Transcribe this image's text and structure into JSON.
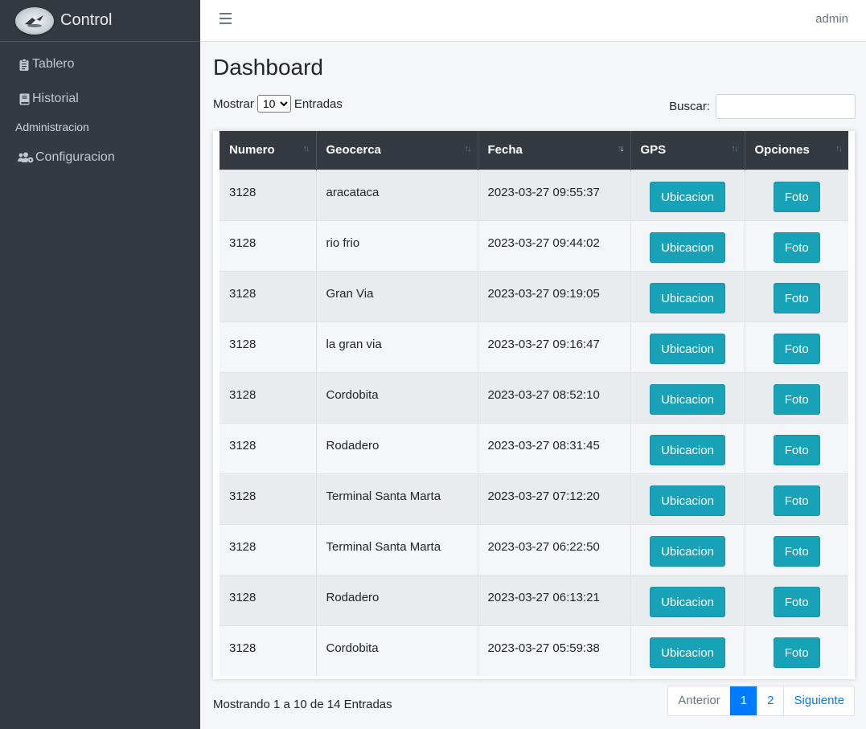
{
  "brand": {
    "name": "Control"
  },
  "sidebar": {
    "items": [
      {
        "label": "Tablero",
        "icon": "clipboard-icon"
      },
      {
        "label": "Historial",
        "icon": "book-icon"
      }
    ],
    "header": "Administracion",
    "admin_items": [
      {
        "label": "Configuracion",
        "icon": "users-cog-icon"
      }
    ]
  },
  "topbar": {
    "user": "admin"
  },
  "page": {
    "title": "Dashboard"
  },
  "table_controls": {
    "show_label": "Mostrar",
    "entries_label": "Entradas",
    "page_length": "10",
    "search_label": "Buscar:",
    "search_value": ""
  },
  "table": {
    "headers": [
      "Numero",
      "Geocerca",
      "Fecha",
      "GPS",
      "Opciones"
    ],
    "rows": [
      {
        "numero": "3128",
        "geocerca": "aracataca",
        "fecha": "2023-03-27 09:55:37",
        "gps": "Ubicacion",
        "opciones": "Foto"
      },
      {
        "numero": "3128",
        "geocerca": "rio frio",
        "fecha": "2023-03-27 09:44:02",
        "gps": "Ubicacion",
        "opciones": "Foto"
      },
      {
        "numero": "3128",
        "geocerca": "Gran Via",
        "fecha": "2023-03-27 09:19:05",
        "gps": "Ubicacion",
        "opciones": "Foto"
      },
      {
        "numero": "3128",
        "geocerca": "la gran via",
        "fecha": "2023-03-27 09:16:47",
        "gps": "Ubicacion",
        "opciones": "Foto"
      },
      {
        "numero": "3128",
        "geocerca": "Cordobita",
        "fecha": "2023-03-27 08:52:10",
        "gps": "Ubicacion",
        "opciones": "Foto"
      },
      {
        "numero": "3128",
        "geocerca": "Rodadero",
        "fecha": "2023-03-27 08:31:45",
        "gps": "Ubicacion",
        "opciones": "Foto"
      },
      {
        "numero": "3128",
        "geocerca": "Terminal Santa Marta",
        "fecha": "2023-03-27 07:12:20",
        "gps": "Ubicacion",
        "opciones": "Foto"
      },
      {
        "numero": "3128",
        "geocerca": "Terminal Santa Marta",
        "fecha": "2023-03-27 06:22:50",
        "gps": "Ubicacion",
        "opciones": "Foto"
      },
      {
        "numero": "3128",
        "geocerca": "Rodadero",
        "fecha": "2023-03-27 06:13:21",
        "gps": "Ubicacion",
        "opciones": "Foto"
      },
      {
        "numero": "3128",
        "geocerca": "Cordobita",
        "fecha": "2023-03-27 05:59:38",
        "gps": "Ubicacion",
        "opciones": "Foto"
      }
    ]
  },
  "footer": {
    "info": "Mostrando 1 a 10 de 14 Entradas",
    "pagination": {
      "previous": "Anterior",
      "pages": [
        "1",
        "2"
      ],
      "active": "1",
      "next": "Siguiente"
    }
  },
  "colors": {
    "sidebar": "#343a40",
    "accent_button": "#17a2b8",
    "page_active": "#007bff"
  }
}
